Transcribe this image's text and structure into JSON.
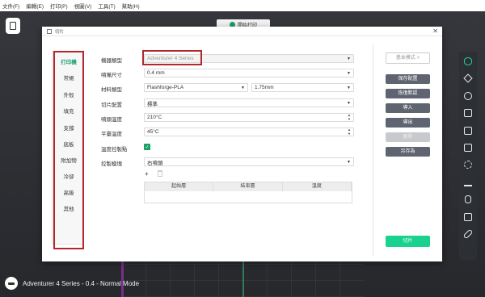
{
  "menubar": [
    "文件(F)",
    "編輯(E)",
    "打印(P)",
    "視圖(V)",
    "工具(T)",
    "幫助(H)"
  ],
  "top_tab": {
    "label": "開始打印"
  },
  "status": {
    "text": "Adventurer 4 Series - 0.4 - Normal Mode"
  },
  "dialog": {
    "title": "切片",
    "categories": [
      "打印機",
      "常規",
      "外殼",
      "填充",
      "支撐",
      "底板",
      "附加物",
      "冷卻",
      "高級",
      "其他"
    ],
    "active_category": "打印機",
    "fields": {
      "machine_type": {
        "label": "機器類型",
        "value": "Adventurer 4 Series"
      },
      "nozzle_size": {
        "label": "噴嘴尺寸",
        "value": "0.4 mm"
      },
      "material_type": {
        "label": "材料類型",
        "value": "Flashforge-PLA",
        "diameter": "1.75mm"
      },
      "slice_config": {
        "label": "切片配置",
        "value": "標準"
      },
      "nozzle_temp": {
        "label": "噴頭溫度",
        "value": "210°C"
      },
      "bed_temp": {
        "label": "平臺溫度",
        "value": "45°C"
      },
      "temp_control": {
        "label": "溫度控製點",
        "checked": true
      },
      "control_mode": {
        "label": "控製模塊",
        "value": "右噴頭"
      }
    },
    "table_headers": [
      "起始層",
      "結束層",
      "溫度"
    ],
    "buttons": {
      "basic_mode": "基本模式 >",
      "save_config": "保存配置",
      "restore_default": "恢復默認",
      "import": "導入",
      "export": "導出",
      "delete": "刪除",
      "save_as": "另存為",
      "slice": "切片"
    }
  }
}
